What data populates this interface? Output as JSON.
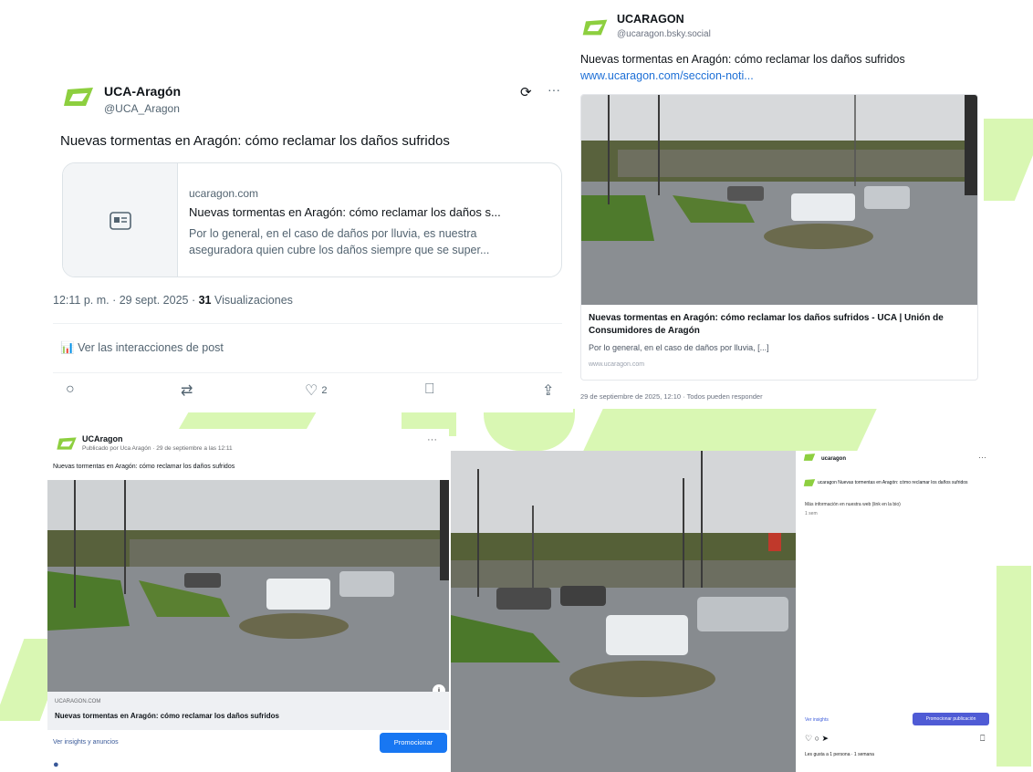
{
  "colors": {
    "brand_green": "#8dcf3f",
    "bg_stripe": "#d9f7b3",
    "link_blue": "#1d6fd6",
    "fb_blue": "#1877f2",
    "ig_blue": "#4f5bd5"
  },
  "tweet": {
    "display_name": "UCA-Aragón",
    "handle": "@UCA_Aragon",
    "text": "Nuevas tormentas en Aragón: cómo reclamar los daños sufridos",
    "link_card": {
      "domain": "ucaragon.com",
      "title": "Nuevas tormentas en Aragón: cómo reclamar los daños s...",
      "desc_line1": "Por lo general, en el caso de daños por lluvia, es nuestra",
      "desc_line2": "aseguradora quien cubre los daños siempre que se super..."
    },
    "meta_time": "12:11 p. m. · 29 sept. 2025 · ",
    "meta_views_count": "31",
    "meta_views_label": " Visualizaciones",
    "interactions": "Ver las interacciones de post",
    "likes": "2"
  },
  "top_right_post": {
    "display_name": "UCARAGON",
    "handle": "@ucaragon.bsky.social",
    "text": "Nuevas tormentas en Aragón: cómo reclamar los daños sufridos",
    "link": "www.ucaragon.com/seccion-noti...",
    "card_title": "Nuevas tormentas en Aragón: cómo reclamar los daños sufridos - UCA | Unión de Consumidores de Aragón",
    "card_desc": "Por lo general, en el caso de daños por lluvia, [...]",
    "card_domain": "www.ucaragon.com",
    "footer": "29 de septiembre de 2025, 12:10 · Todos pueden responder"
  },
  "fb_post": {
    "page_name": "UCAragon",
    "subtitle": "Publicado por Uca Aragón · 29 de septiembre a las 12:11",
    "text": "Nuevas tormentas en Aragón: cómo reclamar los daños sufridos",
    "link_domain": "UCARAGON.COM",
    "link_title": "Nuevas tormentas en Aragón: cómo reclamar los daños sufridos",
    "stats": "Ver insights y anuncios",
    "promote": "Promocionar"
  },
  "ig_panel": {
    "account": "ucaragon",
    "caption": "ucaragon Nuevas tormentas en Aragón: cómo reclamar los daños sufridos",
    "caption2": "Más información en nuestra web (link en la bio)",
    "caption3": "1 sem",
    "insights": "Ver insights",
    "boost": "Promocionar publicación",
    "liked_by": "Les gusta a 1 persona · 1 semana"
  }
}
